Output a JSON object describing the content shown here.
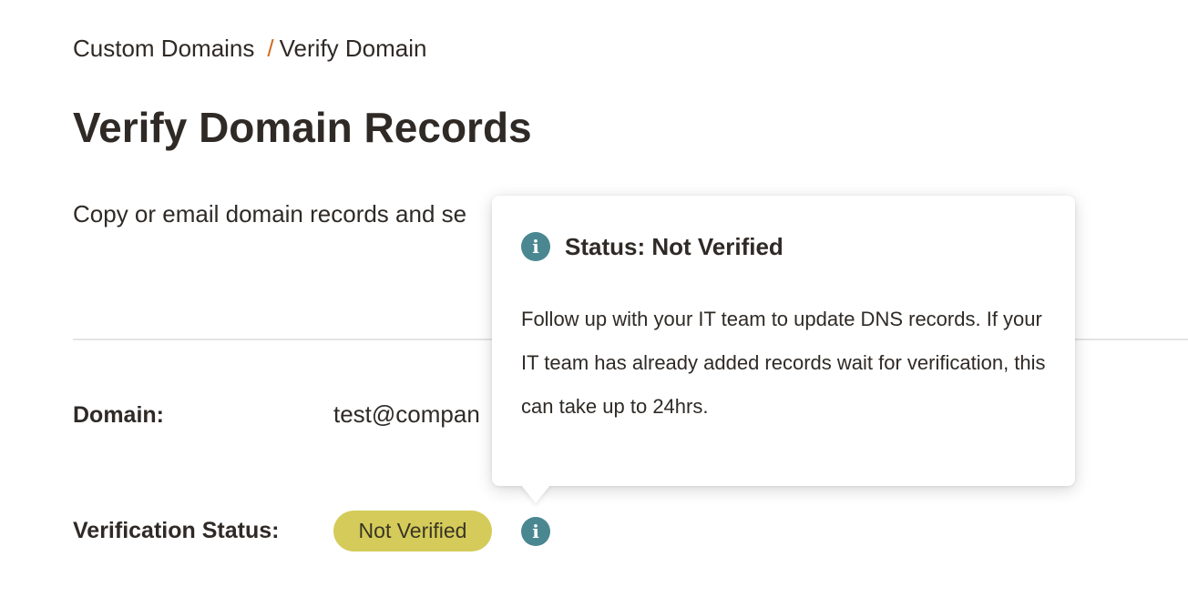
{
  "breadcrumb": {
    "parent": "Custom Domains",
    "separator": "/",
    "current": "Verify Domain"
  },
  "page": {
    "title": "Verify Domain Records",
    "description": "Copy or email domain records and se"
  },
  "fields": {
    "domain_label": "Domain:",
    "domain_value": "test@compan",
    "status_label": "Verification Status:",
    "status_value": "Not Verified"
  },
  "tooltip": {
    "title": "Status: Not Verified",
    "body": "Follow up with your IT team to update DNS records. If your IT team has already added records wait for verification, this can take up to 24hrs."
  },
  "icons": {
    "info_icon_glyph": "i",
    "info_icon_name": "info-icon"
  },
  "colors": {
    "accent_separator": "#d2691e",
    "badge_background": "#d4cb5a",
    "info_icon": "#4a8791",
    "text": "#2f2a26"
  }
}
